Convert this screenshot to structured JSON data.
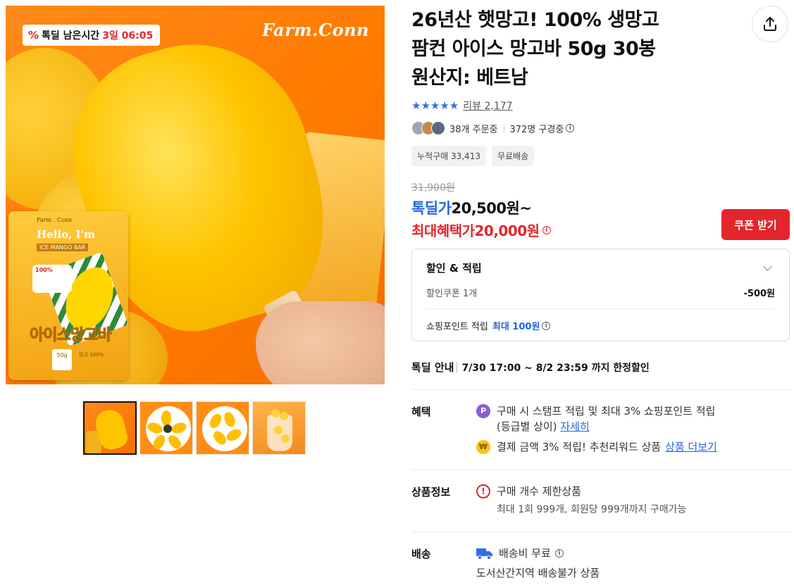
{
  "hero": {
    "brand": "Farm.Conn",
    "timer_label": "톡딜 남은시간",
    "timer_value": "3일 06:05",
    "pack_brand": "Farm . Conn",
    "pack_hello": "Hello, I'm",
    "pack_sub": "ICE MANGO BAR",
    "pack_badge": "100%",
    "pack_title": "아이스망고바",
    "pack_weight": "50g",
    "pack_note": "망고 100%"
  },
  "product": {
    "title_lines": [
      "26년산 햇망고! 100% 생망고",
      "팜컨 아이스 망고바 50g 30봉",
      "원산지: 베트남"
    ],
    "stars": "★★★★★",
    "review_link": "리뷰 2,177",
    "ordering": "38개 주문중",
    "viewing": "372명 구경중",
    "tags": [
      "누적구매 33,413",
      "무료배송"
    ],
    "original_price": "31,900원",
    "deal_label": "톡딜가",
    "deal_price": "20,500원~",
    "max_benefit_label": "최대혜택가",
    "max_benefit_price": "20,000원",
    "coupon_button": "쿠폰 받기"
  },
  "discount_box": {
    "title": "할인 & 적립",
    "coupon_label": "할인쿠폰 1개",
    "coupon_amount": "-500원",
    "point_label": "쇼핑포인트 적립",
    "point_max": "최대 100원"
  },
  "deal_info": {
    "label": "톡딜 안내",
    "value": "7/30 17:00 ~ 8/2 23:59 까지 한정할인"
  },
  "benefits": {
    "label": "혜택",
    "line1": "구매 시 스탬프 적립 및 최대 3% 쇼핑포인트 적립",
    "line1b": "(등급별 상이)",
    "line1_link": "자세히",
    "line2": "결제 금액 3% 적립! 추천리워드 상품",
    "line2_link": "상품 더보기"
  },
  "product_info": {
    "label": "상품정보",
    "line1": "구매 개수 제한상품",
    "line2": "최대 1회 999개, 회원당 999개까지 구매가능"
  },
  "shipping": {
    "label": "배송",
    "line1": "배송비 무료",
    "line2": "도서산간지역 배송불가 상품"
  },
  "colors": {
    "accent_blue": "#1f66e0",
    "accent_red": "#e3262c",
    "hero_orange": "#ff7a00"
  }
}
